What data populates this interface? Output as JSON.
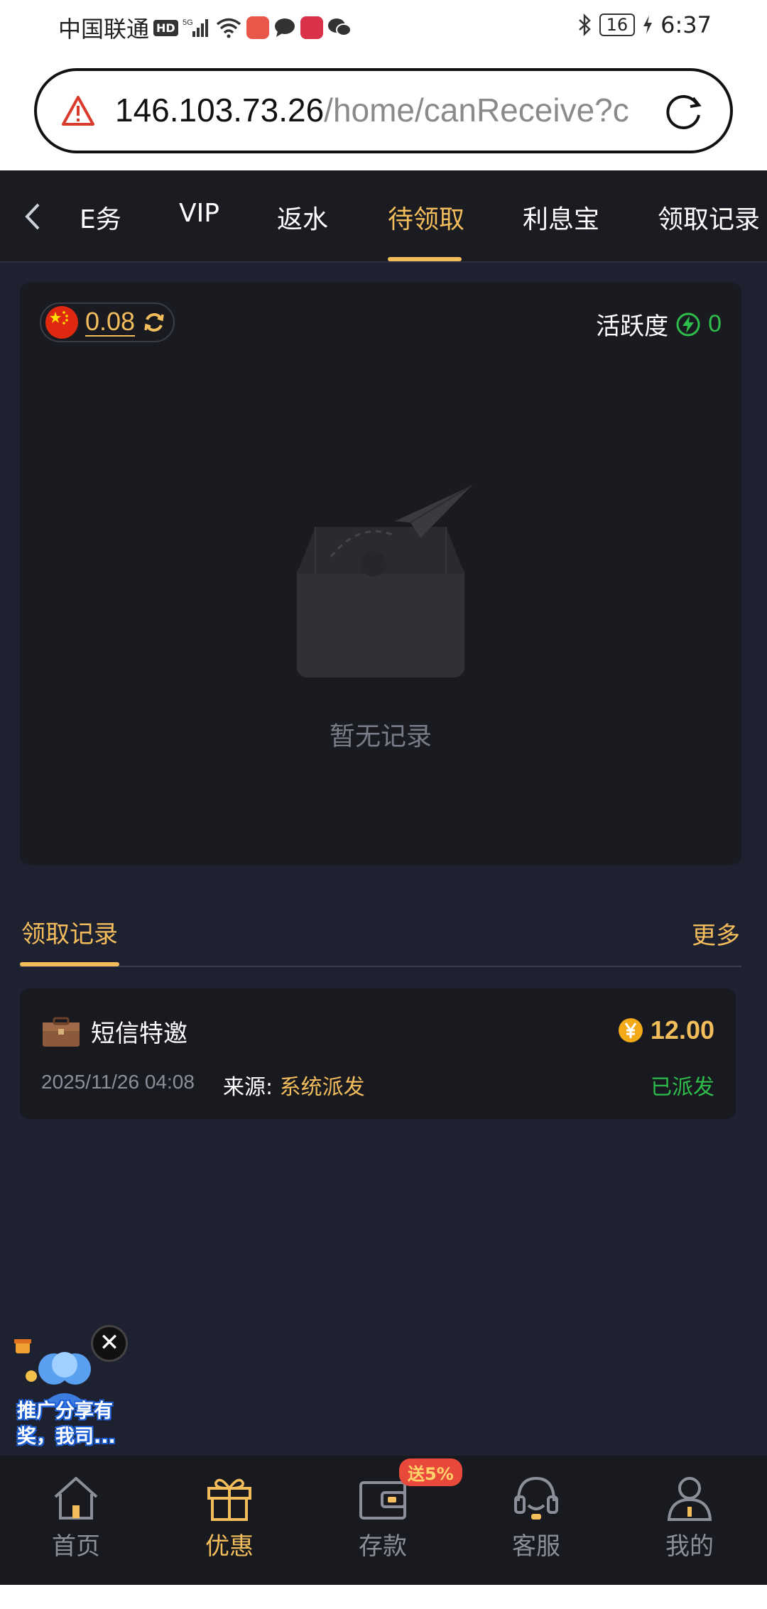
{
  "status_bar": {
    "carrier": "中国联通",
    "hd_label": "HD",
    "network": "5G",
    "battery": "16",
    "time": "6:37"
  },
  "url_bar": {
    "host": "146.103.73.26",
    "path": "/home/canReceive?c"
  },
  "tabs": {
    "items": [
      {
        "label": "E务"
      },
      {
        "label": "VIP"
      },
      {
        "label": "返水"
      },
      {
        "label": "待领取"
      },
      {
        "label": "利息宝"
      },
      {
        "label": "领取记录"
      }
    ],
    "active_index": 3
  },
  "summary": {
    "balance": "0.08",
    "activity_label": "活跃度",
    "activity_value": "0"
  },
  "empty_state": {
    "text": "暂无记录"
  },
  "records": {
    "title": "领取记录",
    "more": "更多",
    "items": [
      {
        "name": "短信特邀",
        "amount": "12.00",
        "date": "2025/11/26 04:08",
        "source_label": "来源:",
        "source_value": "系统派发",
        "status": "已派发"
      }
    ]
  },
  "promo": {
    "close": "✕",
    "text": "推广分享有奖，我司..."
  },
  "bottom_nav": {
    "items": [
      {
        "label": "首页",
        "icon": "home-icon"
      },
      {
        "label": "优惠",
        "icon": "gift-icon"
      },
      {
        "label": "存款",
        "icon": "wallet-icon"
      },
      {
        "label": "客服",
        "icon": "headset-icon"
      },
      {
        "label": "我的",
        "icon": "user-icon"
      }
    ],
    "active_index": 1,
    "deposit_badge": "送5%"
  },
  "colors": {
    "accent": "#f3bd5c",
    "success": "#2ebd4a",
    "background": "#1e2130",
    "card": "#1a1b21"
  }
}
